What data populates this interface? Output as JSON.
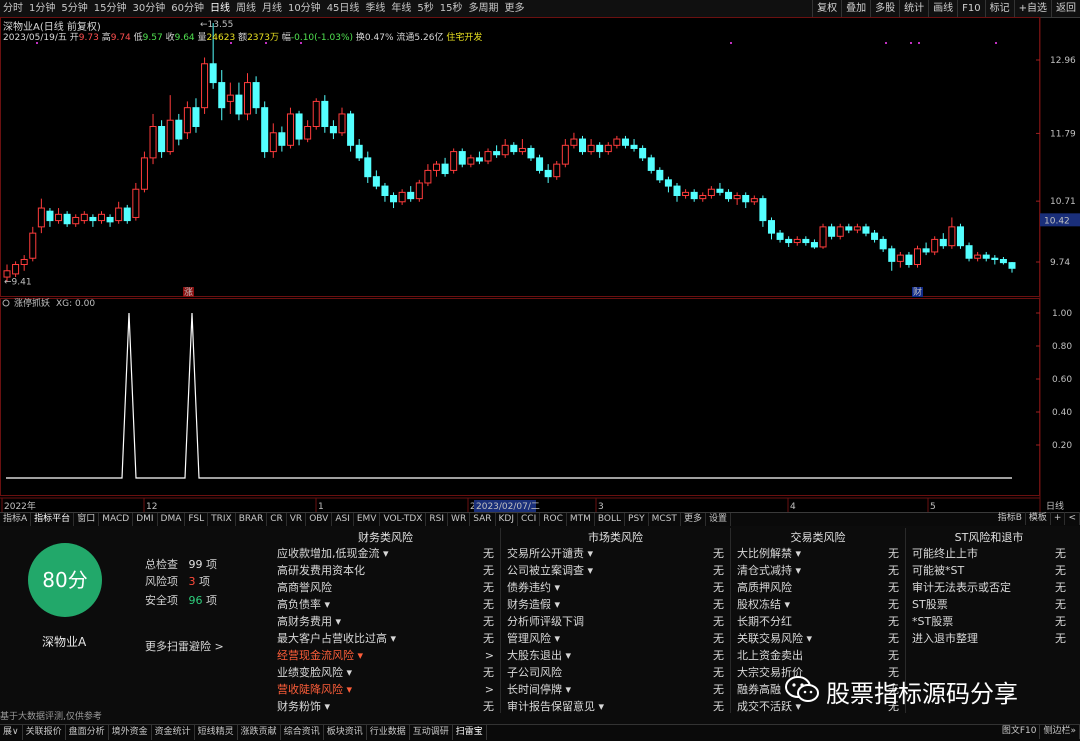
{
  "period_bar": {
    "items": [
      "分时",
      "1分钟",
      "5分钟",
      "15分钟",
      "30分钟",
      "60分钟",
      "日线",
      "周线",
      "月线",
      "10分钟",
      "45日线",
      "季线",
      "年线",
      "5秒",
      "15秒",
      "多周期",
      "更多"
    ],
    "active": "日线",
    "right_tools": [
      "复权",
      "叠加",
      "多股",
      "统计",
      "画线",
      "F10",
      "标记",
      "+自选",
      "返回"
    ]
  },
  "stock_info": {
    "title": "深物业A(日线 前复权)",
    "date": "2023/05/19/五",
    "open_label": "开",
    "open": "9.73",
    "high_label": "高",
    "high": "9.74",
    "low_label": "低",
    "low": "9.57",
    "close_label": "收",
    "close": "9.64",
    "volume_label": "量",
    "volume": "24623",
    "amount_label": "额",
    "amount": "2373万",
    "change_label": "幅",
    "change": "-0.10(-1.03%)",
    "turnover_label": "换",
    "turnover": "0.47%",
    "float_label": "流通",
    "float_value": "5.26亿",
    "sector": "住宅开发"
  },
  "price_chart": {
    "y_ticks": [
      "12.96",
      "11.79",
      "10.71",
      "9.74"
    ],
    "current_price": "10.42",
    "max_label": "13.55",
    "min_label": "9.41",
    "marker_zhang": "涨",
    "marker_cai": "财"
  },
  "indicator": {
    "name": "涨停抓妖",
    "xg": "XG: 0.00",
    "y_ticks": [
      "1.00",
      "0.80",
      "0.60",
      "0.40",
      "0.20"
    ]
  },
  "time_axis": {
    "labels": [
      "2022年",
      "12",
      "1",
      "2",
      "3",
      "4",
      "5"
    ],
    "selected_date": "2023/02/07/二",
    "period": "日线"
  },
  "indicator_tabs": {
    "items": [
      "指标A",
      "指标平台",
      "窗口",
      "MACD",
      "DMI",
      "DMA",
      "FSL",
      "TRIX",
      "BRAR",
      "CR",
      "VR",
      "OBV",
      "ASI",
      "EMV",
      "VOL-TDX",
      "RSI",
      "WR",
      "SAR",
      "KDJ",
      "CCI",
      "ROC",
      "MTM",
      "BOLL",
      "PSY",
      "MCST",
      "更多",
      "设置"
    ],
    "active": "指标平台",
    "right": [
      "指标B",
      "模板",
      "+",
      "<"
    ]
  },
  "risk_summary": {
    "score": "80分",
    "stock_name": "深物业A",
    "more_link": "更多扫雷避险 >",
    "total_label": "总检查",
    "total": "99",
    "total_unit": "项",
    "risk_label": "风险项",
    "risk": "3",
    "risk_unit": "项",
    "safe_label": "安全项",
    "safe": "96",
    "safe_unit": "项",
    "score_color": "#22a86a"
  },
  "risk_columns": [
    {
      "title": "财务类风险",
      "items": [
        {
          "label": "应收款增加,低现金流 ▾",
          "value": "无",
          "warn": false
        },
        {
          "label": "高研发费用资本化",
          "value": "无",
          "warn": false
        },
        {
          "label": "高商誉风险",
          "value": "无",
          "warn": false
        },
        {
          "label": "高负债率 ▾",
          "value": "无",
          "warn": false
        },
        {
          "label": "高财务费用 ▾",
          "value": "无",
          "warn": false
        },
        {
          "label": "最大客户占营收比过高 ▾",
          "value": "无",
          "warn": false
        },
        {
          "label": "经营现金流风险 ▾",
          "value": ">",
          "warn": true
        },
        {
          "label": "业绩变脸风险 ▾",
          "value": "无",
          "warn": false
        },
        {
          "label": "营收陡降风险 ▾",
          "value": ">",
          "warn": true
        },
        {
          "label": "财务粉饰 ▾",
          "value": "无",
          "warn": false
        }
      ]
    },
    {
      "title": "市场类风险",
      "items": [
        {
          "label": "交易所公开谴责 ▾",
          "value": "无",
          "warn": false
        },
        {
          "label": "公司被立案调查 ▾",
          "value": "无",
          "warn": false
        },
        {
          "label": "债券违约 ▾",
          "value": "无",
          "warn": false
        },
        {
          "label": "财务造假 ▾",
          "value": "无",
          "warn": false
        },
        {
          "label": "分析师评级下调",
          "value": "无",
          "warn": false
        },
        {
          "label": "管理风险 ▾",
          "value": "无",
          "warn": false
        },
        {
          "label": "大股东退出 ▾",
          "value": "无",
          "warn": false
        },
        {
          "label": "子公司风险",
          "value": "无",
          "warn": false
        },
        {
          "label": "长时间停牌 ▾",
          "value": "无",
          "warn": false
        },
        {
          "label": "审计报告保留意见 ▾",
          "value": "无",
          "warn": false
        }
      ]
    },
    {
      "title": "交易类风险",
      "items": [
        {
          "label": "大比例解禁 ▾",
          "value": "无",
          "warn": false
        },
        {
          "label": "清仓式减持 ▾",
          "value": "无",
          "warn": false
        },
        {
          "label": "高质押风险",
          "value": "无",
          "warn": false
        },
        {
          "label": "股权冻结 ▾",
          "value": "无",
          "warn": false
        },
        {
          "label": "长期不分红",
          "value": "无",
          "warn": false
        },
        {
          "label": "关联交易风险 ▾",
          "value": "无",
          "warn": false
        },
        {
          "label": "北上资金卖出",
          "value": "无",
          "warn": false
        },
        {
          "label": "大宗交易折价",
          "value": "无",
          "warn": false
        },
        {
          "label": "融券高融",
          "value": "无",
          "warn": false
        },
        {
          "label": "成交不活跃 ▾",
          "value": "无",
          "warn": false
        }
      ]
    },
    {
      "title": "ST风险和退市",
      "items": [
        {
          "label": "可能终止上市",
          "value": "无",
          "warn": false
        },
        {
          "label": "可能被*ST",
          "value": "无",
          "warn": false
        },
        {
          "label": "审计无法表示或否定",
          "value": "无",
          "warn": false
        },
        {
          "label": "ST股票",
          "value": "无",
          "warn": false
        },
        {
          "label": "*ST股票",
          "value": "无",
          "warn": false
        },
        {
          "label": "进入退市整理",
          "value": "无",
          "warn": false
        }
      ]
    }
  ],
  "disclaimer": "基于大数据评测,仅供参考",
  "footer_tabs": {
    "items": [
      "展∨",
      "关联报价",
      "盘面分析",
      "境外资金",
      "资金统计",
      "短线精灵",
      "涨跌贡献",
      "综合资讯",
      "板块资讯",
      "行业数据",
      "互动调研",
      "扫雷宝"
    ],
    "active": "扫雷宝",
    "right": [
      "图文F10",
      "侧边栏»"
    ]
  },
  "watermark": "股票指标源码分享",
  "colors": {
    "up": "#ff3c3c",
    "down": "#54ffff",
    "signal": "#ffffff",
    "panel_bg": "#0c0c0c"
  }
}
